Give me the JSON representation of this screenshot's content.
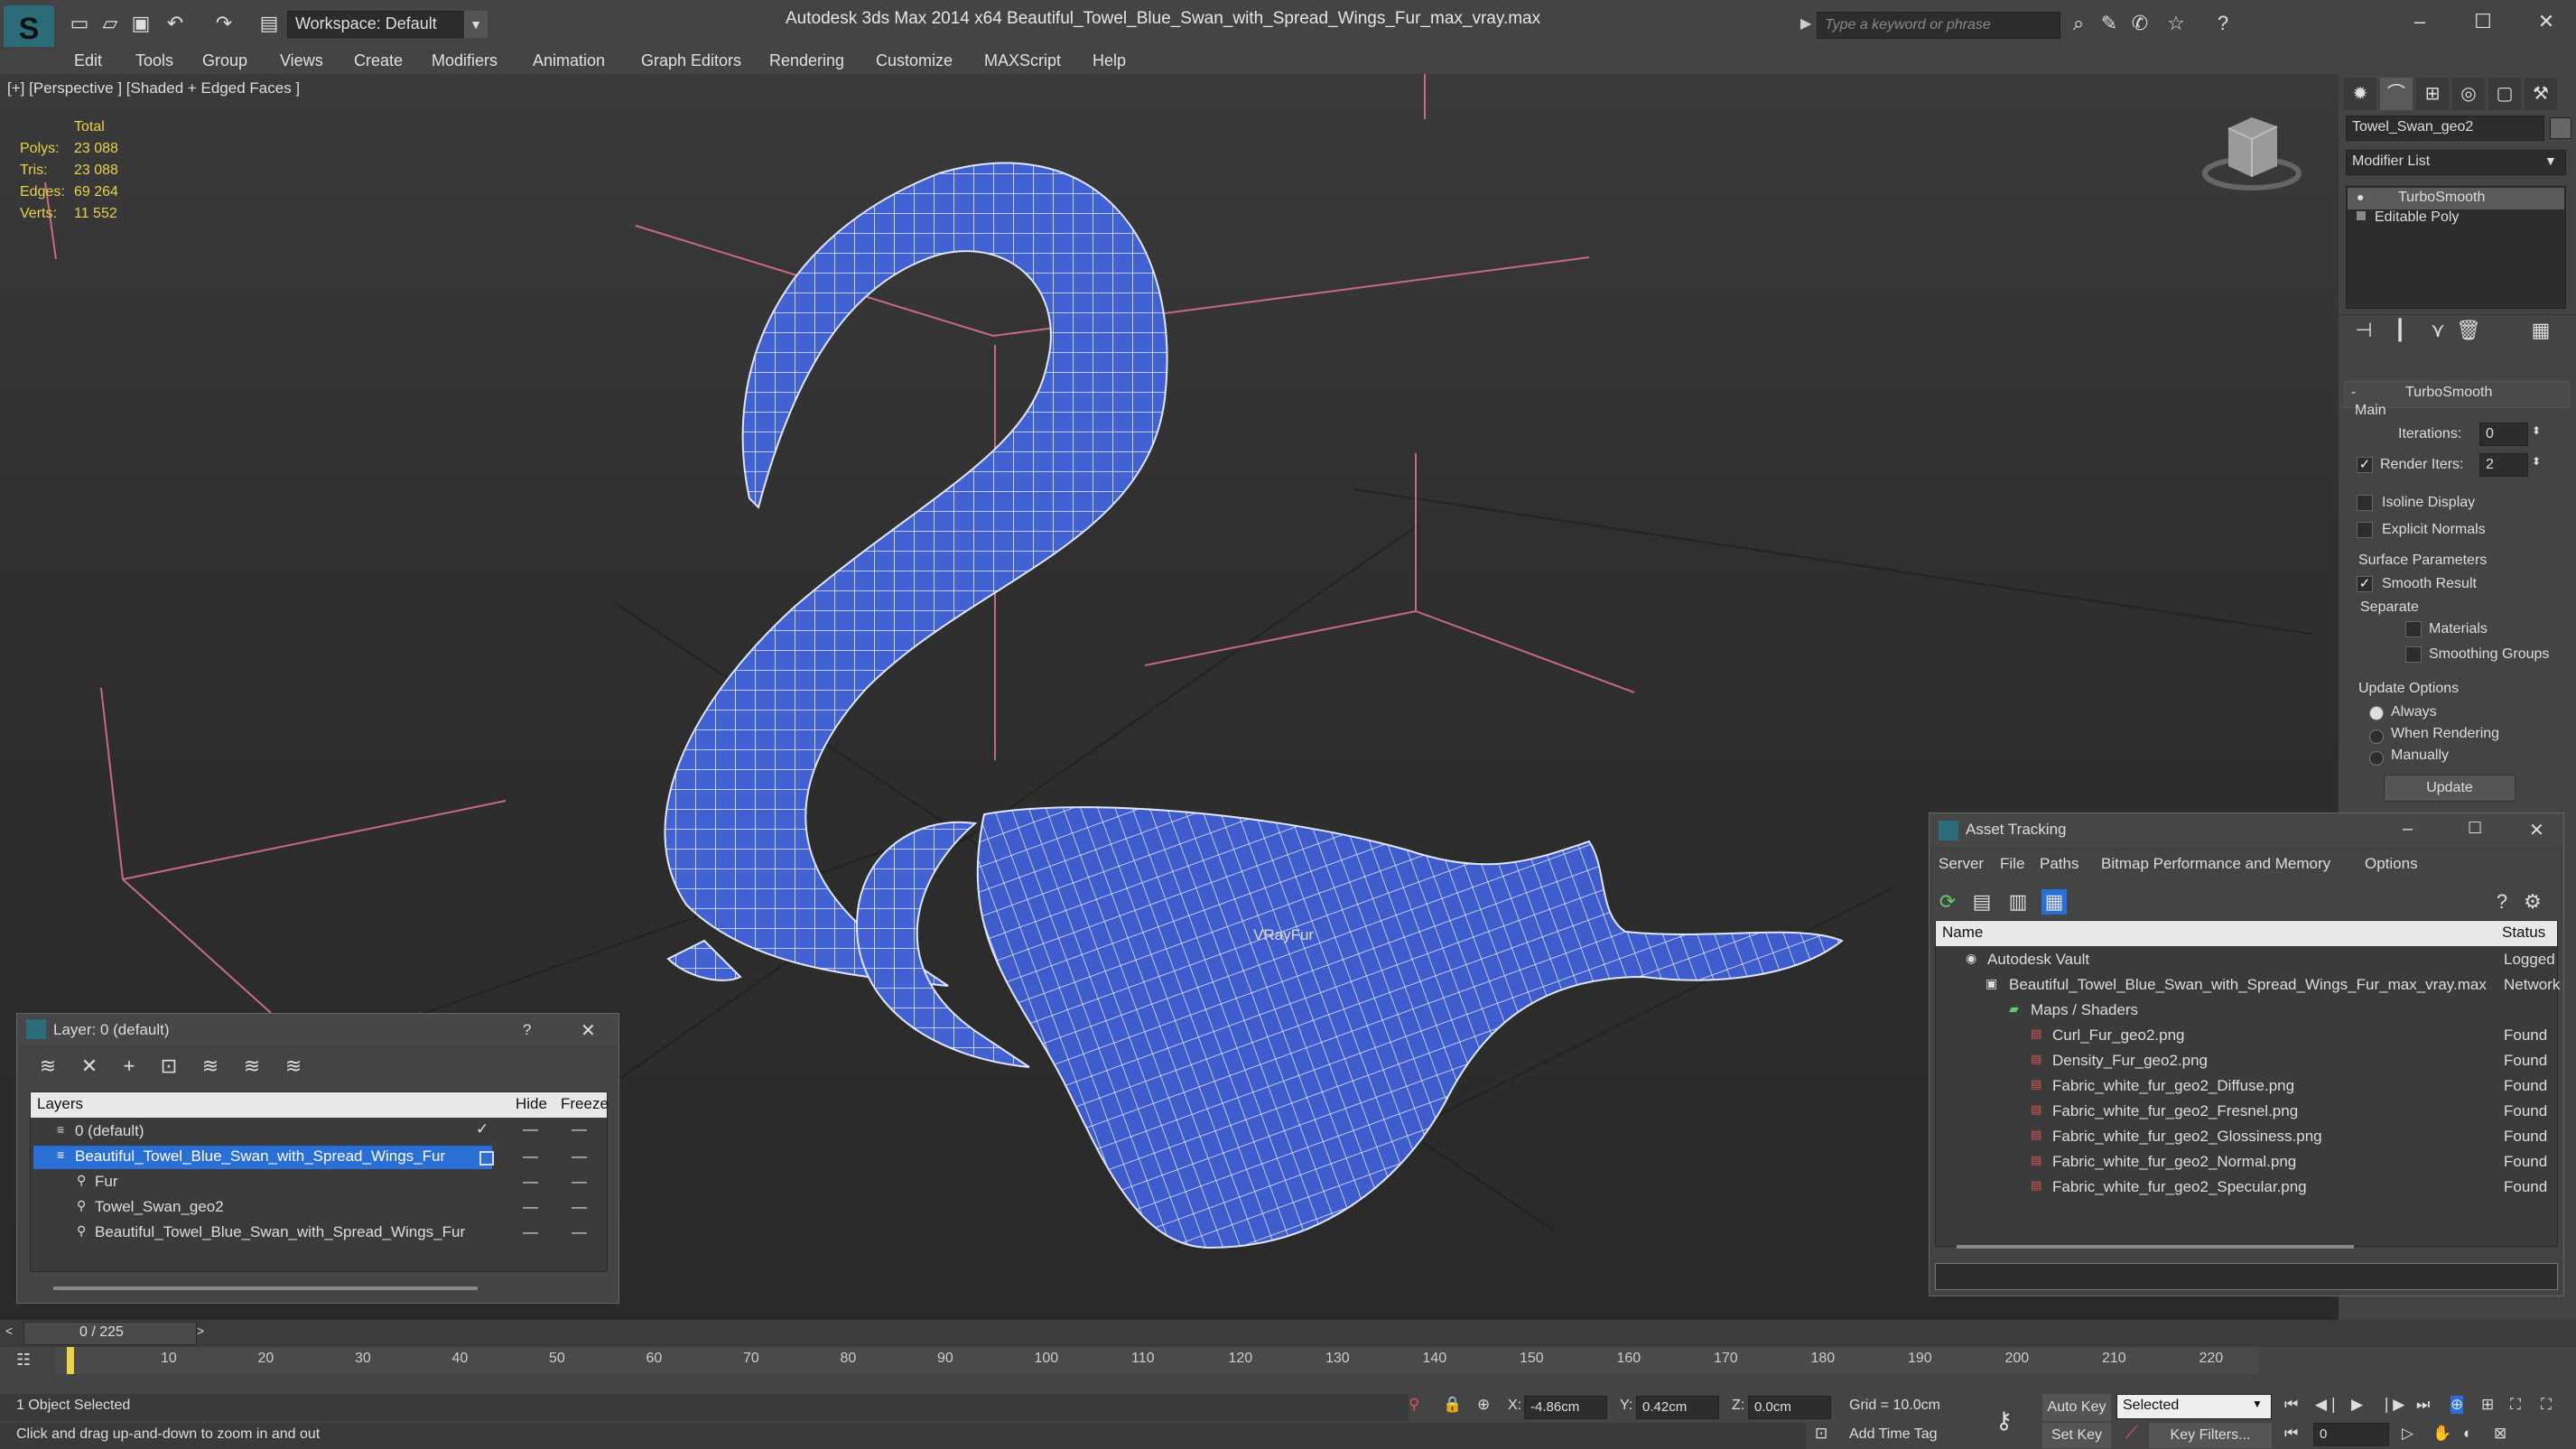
{
  "app": {
    "title": "Autodesk 3ds Max  2014 x64      Beautiful_Towel_Blue_Swan_with_Spread_Wings_Fur_max_vray.max",
    "workspace": "Workspace: Default",
    "search_placeholder": "Type a keyword or phrase"
  },
  "menu": [
    "Edit",
    "Tools",
    "Group",
    "Views",
    "Create",
    "Modifiers",
    "Animation",
    "Graph Editors",
    "Rendering",
    "Customize",
    "MAXScript",
    "Help"
  ],
  "viewport": {
    "label": "[+] [Perspective ] [Shaded + Edged Faces ]",
    "stats_header": "Total",
    "stats": [
      {
        "label": "Polys:",
        "value": "23 088"
      },
      {
        "label": "Tris:",
        "value": "23 088"
      },
      {
        "label": "Edges:",
        "value": "69 264"
      },
      {
        "label": "Verts:",
        "value": "11 552"
      }
    ],
    "vrayfur_label": "VRayFur"
  },
  "command_panel": {
    "object_name": "Towel_Swan_geo2",
    "modifier_list": "Modifier List",
    "stack": [
      "TurboSmooth",
      "Editable Poly"
    ],
    "rollout_title": "TurboSmooth",
    "main_label": "Main",
    "iterations_label": "Iterations:",
    "iterations_value": "0",
    "render_iters_label": "Render Iters:",
    "render_iters_value": "2",
    "isoline_label": "Isoline Display",
    "explicit_normals_label": "Explicit Normals",
    "surface_params_label": "Surface Parameters",
    "smooth_result_label": "Smooth Result",
    "separate_label": "Separate",
    "materials_label": "Materials",
    "smoothing_groups_label": "Smoothing Groups",
    "update_options_label": "Update Options",
    "always_label": "Always",
    "when_rendering_label": "When Rendering",
    "manually_label": "Manually",
    "update_button": "Update"
  },
  "layer_panel": {
    "title": "Layer: 0 (default)",
    "help": "?",
    "col_layers": "Layers",
    "col_hide": "Hide",
    "col_freeze": "Freeze",
    "rows": [
      {
        "name": "0 (default)"
      },
      {
        "name": "Beautiful_Towel_Blue_Swan_with_Spread_Wings_Fur"
      },
      {
        "name": "Fur"
      },
      {
        "name": "Towel_Swan_geo2"
      },
      {
        "name": "Beautiful_Towel_Blue_Swan_with_Spread_Wings_Fur"
      }
    ]
  },
  "asset_tracking": {
    "title": "Asset Tracking",
    "menu": [
      "Server",
      "File",
      "Paths",
      "Bitmap Performance and Memory",
      "Options"
    ],
    "col_name": "Name",
    "col_status": "Status",
    "rows": [
      {
        "name": "Autodesk Vault",
        "status": "Logged"
      },
      {
        "name": "Beautiful_Towel_Blue_Swan_with_Spread_Wings_Fur_max_vray.max",
        "status": "Network"
      },
      {
        "name": "Maps / Shaders",
        "status": ""
      },
      {
        "name": "Curl_Fur_geo2.png",
        "status": "Found"
      },
      {
        "name": "Density_Fur_geo2.png",
        "status": "Found"
      },
      {
        "name": "Fabric_white_fur_geo2_Diffuse.png",
        "status": "Found"
      },
      {
        "name": "Fabric_white_fur_geo2_Fresnel.png",
        "status": "Found"
      },
      {
        "name": "Fabric_white_fur_geo2_Glossiness.png",
        "status": "Found"
      },
      {
        "name": "Fabric_white_fur_geo2_Normal.png",
        "status": "Found"
      },
      {
        "name": "Fabric_white_fur_geo2_Specular.png",
        "status": "Found"
      }
    ]
  },
  "timeline": {
    "frame": "0 / 225",
    "ticks": [
      "10",
      "20",
      "30",
      "40",
      "50",
      "60",
      "70",
      "80",
      "90",
      "100",
      "110",
      "120",
      "130",
      "140",
      "150",
      "160",
      "170",
      "180",
      "190",
      "200",
      "210",
      "220"
    ]
  },
  "status": {
    "selection": "1 Object Selected",
    "prompt": "Click and drag up-and-down to zoom in and out",
    "x_label": "X:",
    "x_value": "-4.86cm",
    "y_label": "Y:",
    "y_value": "0.42cm",
    "z_label": "Z:",
    "z_value": "0.0cm",
    "grid": "Grid = 10.0cm",
    "add_time_tag": "Add Time Tag",
    "auto_key": "Auto Key",
    "set_key": "Set Key",
    "selected": "Selected",
    "key_filters": "Key Filters...",
    "frame_value": "0"
  },
  "colors": {
    "swan_blue": "#3f5fd0",
    "ui_bg": "#444444",
    "selection_blue": "#2a6fd6",
    "stats_yellow": "#e8d24a"
  }
}
